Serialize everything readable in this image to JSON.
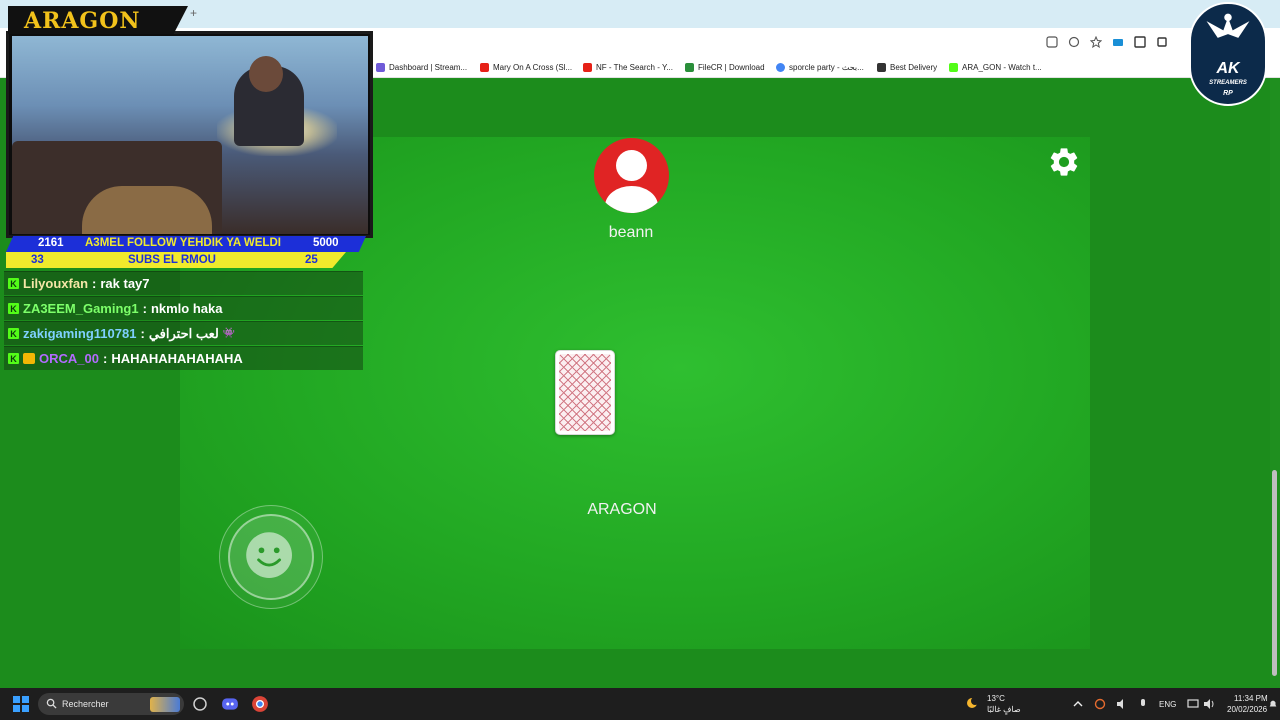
{
  "overlay": {
    "brand": "ARAGON",
    "goal_bar": {
      "left": "2161",
      "label": "A3MEL FOLLOW YEHDIK YA WELDI",
      "right": "5000"
    },
    "subs_bar": {
      "left": "33",
      "label": "SUBS EL RMOU",
      "right": "25"
    },
    "chat": [
      {
        "user": "Lilyouxfan",
        "message": "rak tay7",
        "user_color": "#f5e6a8",
        "badge": ""
      },
      {
        "user": "ZA3EEM_Gaming1",
        "message": "nkmlo haka",
        "user_color": "#7dff6a",
        "badge": ""
      },
      {
        "user": "zakigaming110781",
        "message": "لعب احترافي",
        "user_color": "#7fd0ff",
        "badge": "",
        "emote": "👾"
      },
      {
        "user": "ORCA_00",
        "message": "HAHAHAHAHAHAHA",
        "user_color": "#b36bff",
        "badge": "crown"
      }
    ],
    "ak_logo": {
      "text": "AK",
      "sub": "STREAMERS",
      "rp": "RP"
    }
  },
  "browser": {
    "bookmarks": [
      {
        "label": "Dashboard | Stream...",
        "icon_color": "#6f5bd8"
      },
      {
        "label": "Mary On A Cross (Sl...",
        "icon_color": "#e62117"
      },
      {
        "label": "NF - The Search - Y...",
        "icon_color": "#e62117"
      },
      {
        "label": "FileCR | Download",
        "icon_color": "#2a8f3a"
      },
      {
        "label": "sporcle party - بحث...",
        "icon_color": "#4285f4"
      },
      {
        "label": "Best Delivery",
        "icon_color": "#333333"
      },
      {
        "label": "ARA_GON - Watch t...",
        "icon_color": "#53fc18"
      }
    ]
  },
  "game": {
    "opponent_name": "beann",
    "player_name": "ARAGON",
    "settings_icon": "gear-icon",
    "emoji_button_icon": "smiley-icon"
  },
  "taskbar": {
    "search_placeholder": "Rechercher",
    "weather_temp": "13°C",
    "weather_desc": "صافٍ غالبًا",
    "language": "ENG",
    "time": "11:34 PM",
    "date": "20/02/2026"
  }
}
